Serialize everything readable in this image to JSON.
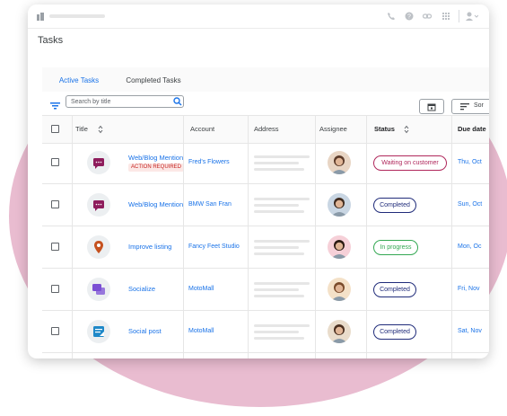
{
  "page": {
    "title": "Tasks"
  },
  "tabs": [
    {
      "label": "Active Tasks",
      "active": true
    },
    {
      "label": "Completed Tasks",
      "active": false
    }
  ],
  "search": {
    "placeholder": "Search by title"
  },
  "sort": {
    "label": "Sor"
  },
  "columns": {
    "title": "Title",
    "account": "Account",
    "address": "Address",
    "assignee": "Assignee",
    "status": "Status",
    "due": "Due date"
  },
  "rows": [
    {
      "title": "Web/Blog Mention",
      "badge": "ACTION REQUIRED",
      "account": "Fred's Flowers",
      "status": "Waiting on customer",
      "status_color": "#b0285c",
      "due": "Thu, Oct",
      "icon": "chat-icon",
      "icon_color": "#8e1c5c"
    },
    {
      "title": "Web/Blog Mention",
      "badge": "",
      "account": "BMW San Fran",
      "status": "Completed",
      "status_color": "#202c7a",
      "due": "Sun, Oct",
      "icon": "chat-icon",
      "icon_color": "#8e1c5c"
    },
    {
      "title": "Improve listing",
      "badge": "",
      "account": "Fancy Feet Studio",
      "status": "In progress",
      "status_color": "#34a853",
      "due": "Mon, Oc",
      "icon": "map-pin-icon",
      "icon_color": "#c5511f"
    },
    {
      "title": "Socialize",
      "badge": "",
      "account": "MotoMall",
      "status": "Completed",
      "status_color": "#202c7a",
      "due": "Fri, Nov",
      "icon": "comments-icon",
      "icon_color": "#7b4fd4"
    },
    {
      "title": "Social post",
      "badge": "",
      "account": "MotoMall",
      "status": "Completed",
      "status_color": "#202c7a",
      "due": "Sat, Nov",
      "icon": "post-icon",
      "icon_color": "#1e88c8"
    }
  ]
}
